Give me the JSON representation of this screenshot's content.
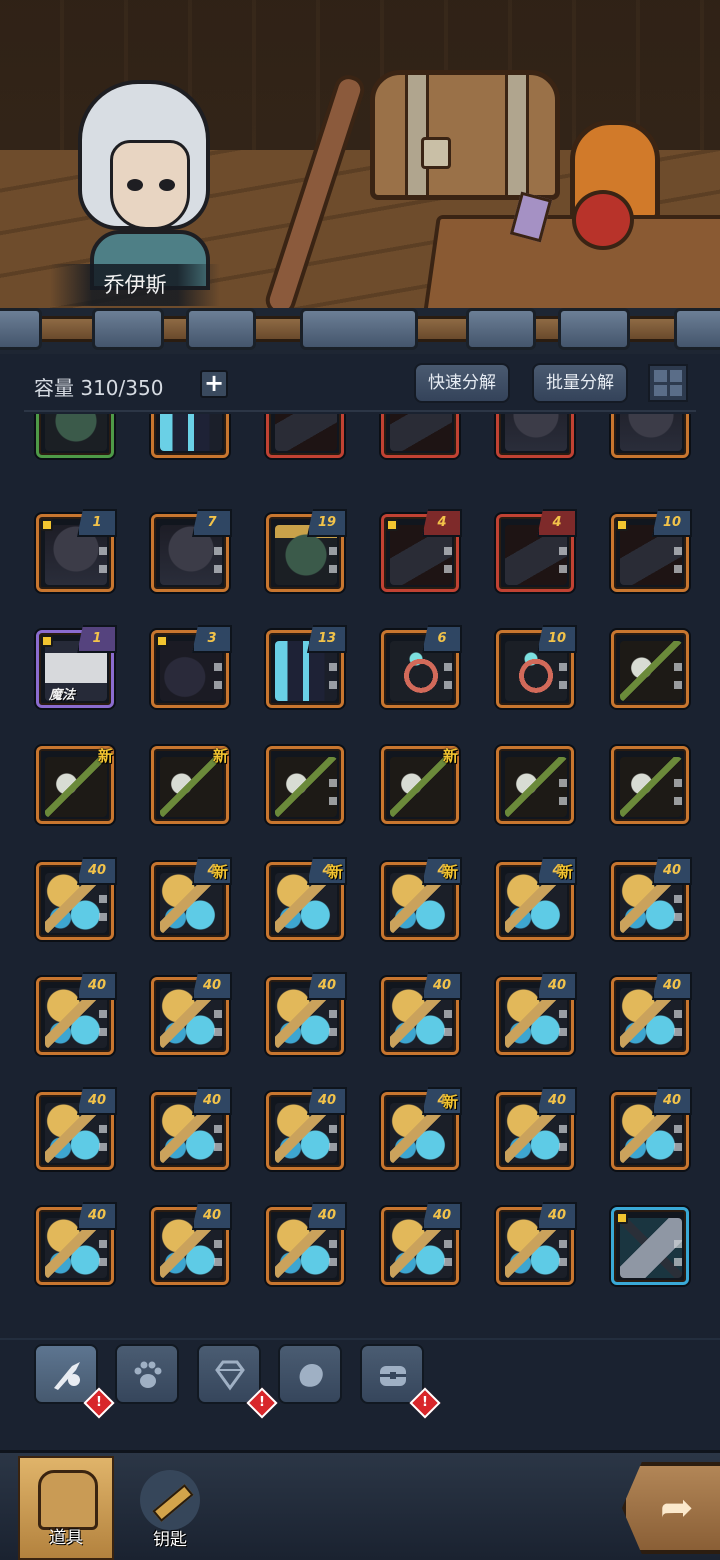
{
  "hero": {
    "name": "乔伊斯"
  },
  "header": {
    "capacity_label": "容量",
    "capacity_value": "310/350",
    "plus_symbol": "+",
    "quick_decompose": "快速分解",
    "batch_decompose": "批量分解"
  },
  "slot_labels": {
    "new": "新",
    "magic_tag": "魔法"
  },
  "rows": [
    [
      "",
      "",
      "",
      "",
      "",
      ""
    ],
    [
      "1",
      "7",
      "19",
      "4",
      "4",
      "10"
    ],
    [
      "1",
      "3",
      "13",
      "6",
      "10",
      ""
    ],
    [
      "",
      "",
      "",
      "",
      "",
      ""
    ],
    [
      "40",
      "4",
      "4",
      "4",
      "4",
      "40"
    ],
    [
      "40",
      "40",
      "40",
      "40",
      "40",
      "40"
    ],
    [
      "40",
      "40",
      "40",
      "4",
      "40",
      "40"
    ],
    [
      "40",
      "40",
      "40",
      "40",
      "40",
      ""
    ]
  ],
  "categories": [
    {
      "icon": "weapon-icon",
      "alert": "!"
    },
    {
      "icon": "paw-icon",
      "alert": ""
    },
    {
      "icon": "gem-icon",
      "alert": "!"
    },
    {
      "icon": "material-icon",
      "alert": ""
    },
    {
      "icon": "box-icon",
      "alert": "!"
    }
  ],
  "nav": {
    "items_label": "道具",
    "keys_label": "钥匙"
  },
  "colors": {
    "orange_frame": "#c8762f",
    "red_frame": "#c14233",
    "purple_frame": "#8b6ccf",
    "blue_frame": "#3aa9d6",
    "green_frame": "#4e9a48",
    "level_text": "#f2c34a",
    "new_text": "#f2c430"
  }
}
